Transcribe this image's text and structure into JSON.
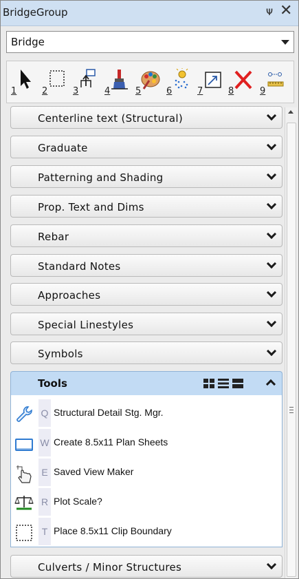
{
  "window": {
    "title": "BridgeGroup",
    "pin_glyph": "ᴪ",
    "close_glyph": "✕"
  },
  "combo": {
    "value": "Bridge"
  },
  "toolbar": {
    "buttons": [
      {
        "num": "1",
        "icon": "arrow-select-icon"
      },
      {
        "num": "2",
        "icon": "dashed-selection-icon"
      },
      {
        "num": "3",
        "icon": "place-cell-icon"
      },
      {
        "num": "4",
        "icon": "paint-brush-icon"
      },
      {
        "num": "5",
        "icon": "palette-icon"
      },
      {
        "num": "6",
        "icon": "bulb-dots-icon"
      },
      {
        "num": "7",
        "icon": "scale-frame-icon"
      },
      {
        "num": "8",
        "icon": "delete-x-icon"
      },
      {
        "num": "9",
        "icon": "measure-icon"
      }
    ]
  },
  "groups": [
    {
      "label": "Centerline text (Structural)"
    },
    {
      "label": "Graduate"
    },
    {
      "label": "Patterning and Shading"
    },
    {
      "label": "Prop. Text and Dims"
    },
    {
      "label": "Rebar"
    },
    {
      "label": "Standard Notes"
    },
    {
      "label": "Approaches"
    },
    {
      "label": "Special Linestyles"
    },
    {
      "label": "Symbols"
    }
  ],
  "tools_group": {
    "label": "Tools",
    "items": [
      {
        "key": "Q",
        "label": "Structural Detail Stg. Mgr.",
        "icon": "wrench-icon"
      },
      {
        "key": "W",
        "label": "Create 8.5x11 Plan Sheets",
        "icon": "sheet-icon"
      },
      {
        "key": "E",
        "label": "Saved View Maker",
        "icon": "hand-pointer-icon"
      },
      {
        "key": "R",
        "label": "Plot Scale?",
        "icon": "balance-scale-icon"
      },
      {
        "key": "T",
        "label": "Place 8.5x11 Clip Boundary",
        "icon": "dashed-rect-icon"
      }
    ]
  },
  "groups_after": [
    {
      "label": "Culverts / Minor Structures"
    }
  ],
  "colors": {
    "titlebar": "#cfe0f2",
    "tools_header": "#c2dbf4",
    "accent": "#2277cc"
  }
}
